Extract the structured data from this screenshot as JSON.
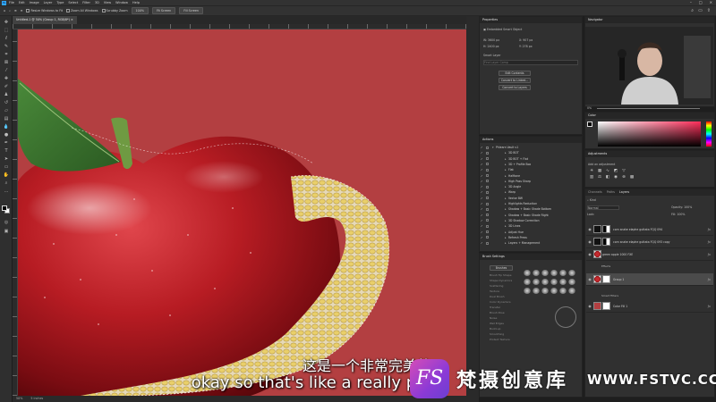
{
  "menubar": {
    "items": [
      "File",
      "Edit",
      "Image",
      "Layer",
      "Type",
      "Select",
      "Filter",
      "3D",
      "View",
      "Window",
      "Help"
    ]
  },
  "options": {
    "resize_windows": "Resize Windows to Fit",
    "zoom_all": "Zoom All Windows",
    "scrubby_zoom": "Scrubby Zoom",
    "zoom_pct": "100%",
    "fit_screen": "Fit Screen",
    "fill_screen": "Fill Screen"
  },
  "document": {
    "tab": "Untitled-1 @ 50% (Group 1, RGB/8*) ×"
  },
  "status": {
    "zoom": "50%",
    "info": "5 inches"
  },
  "properties": {
    "title": "Properties",
    "kind": "Embedded Smart Object",
    "w": "W: 3600 px",
    "h": "H: 2400 px",
    "x": "X: 907 px",
    "y": "Y: 278 px",
    "smart_label": "Smart Layer",
    "search_placeholder": "Find Layer Comp",
    "btn_edit": "Edit Contents",
    "btn_convert": "Convert to Linked...",
    "btn_layers": "Convert to Layers"
  },
  "actions": {
    "title": "Actions",
    "items": [
      "Phlearn Vault v1",
      "3D BOT",
      "3D BOT + Flat",
      "3D + Profile Box",
      "Flat",
      "Halftone",
      "High Pass Sharp",
      "3D Angle",
      "Warp",
      "Vector BW",
      "Highlights Reduction",
      "Shadow + Basic Shade Bottom",
      "Shadow + Basic Shade Right",
      "3D Shadow Correction",
      "3D Lines",
      "Adjust Hue",
      "Refresh Press",
      "Layers + Management"
    ]
  },
  "brush_settings": {
    "title": "Brush Settings",
    "brushes_btn": "Brushes",
    "options": [
      "Brush Tip Shape",
      "Shape Dynamics",
      "Scattering",
      "Texture",
      "Dual Brush",
      "Color Dynamics",
      "Transfer",
      "Brush Pose",
      "Noise",
      "Wet Edges",
      "Build-up",
      "Smoothing",
      "Protect Texture"
    ]
  },
  "color": {
    "title": "Color",
    "accent": "#ff2e5a",
    "canvas_bg": "#b33f41"
  },
  "adjustments": {
    "title": "Adjustments",
    "subtitle": "Add an adjustment"
  },
  "layers": {
    "tabs": [
      "Channels",
      "Paths",
      "Layers"
    ],
    "blend": "Normal",
    "opacity": "Opacity: 100%",
    "fill": "Fill: 100%",
    "lock": "Lock:",
    "kind": "Kind",
    "rows": [
      {
        "name": "corn snake elaphe guttata FQQ 094",
        "thumb": "dark",
        "mask": "blk"
      },
      {
        "name": "corn snake elaphe guttata FQQ 093 copy",
        "thumb": "dark",
        "mask": "blk"
      },
      {
        "name": "green apple 1000 FXE",
        "thumb": "apple",
        "mask": "none"
      },
      {
        "name": "Group 1",
        "thumb": "apple",
        "mask": "mask"
      },
      {
        "name": "Color Fill 1",
        "thumb": "red",
        "mask": "mask"
      }
    ],
    "sub": {
      "effects": "Effects",
      "smart_filters": "Smart Filters",
      "effects2": "Effects",
      "smart_filters2": "Smart Filters"
    }
  },
  "subtitles": {
    "cn": "这是一个非常完美的",
    "en": "okay so that's like a really pe"
  },
  "watermark": {
    "logo": "FS",
    "cn": "梵摄创意库",
    "url": "WWW.FSTVC.CC"
  }
}
